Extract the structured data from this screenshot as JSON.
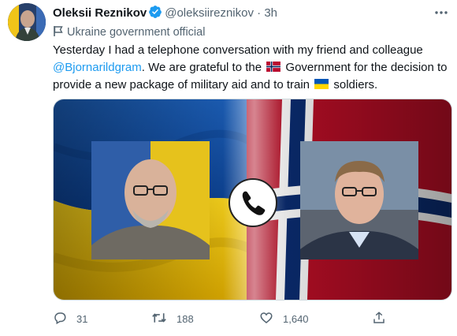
{
  "tweet": {
    "author_name": "Oleksii Reznikov",
    "handle": "@oleksiireznikov",
    "separator": "·",
    "time": "3h",
    "label": "Ukraine government official",
    "text_1": "Yesterday I had a telephone conversation with my friend and colleague",
    "mention": "@Bjornarildgram",
    "text_2": ". We are grateful to the",
    "text_3": "Government for the decision to provide a new package of military aid and to train",
    "text_4": "soldiers."
  },
  "actions": {
    "replies": "31",
    "retweets": "188",
    "likes": "1,640"
  },
  "icons": {
    "verified": "verified-badge-icon",
    "more": "more-options-icon",
    "label": "government-flag-icon",
    "reply": "reply-icon",
    "retweet": "retweet-icon",
    "like": "heart-icon",
    "share": "share-icon",
    "phone": "phone-icon"
  },
  "colors": {
    "accent": "#1d9bf0",
    "muted": "#536471",
    "ukraine_blue": "#0057b7",
    "ukraine_yellow": "#ffd700",
    "norway_red": "#ba0c2f",
    "norway_blue": "#00205b"
  }
}
